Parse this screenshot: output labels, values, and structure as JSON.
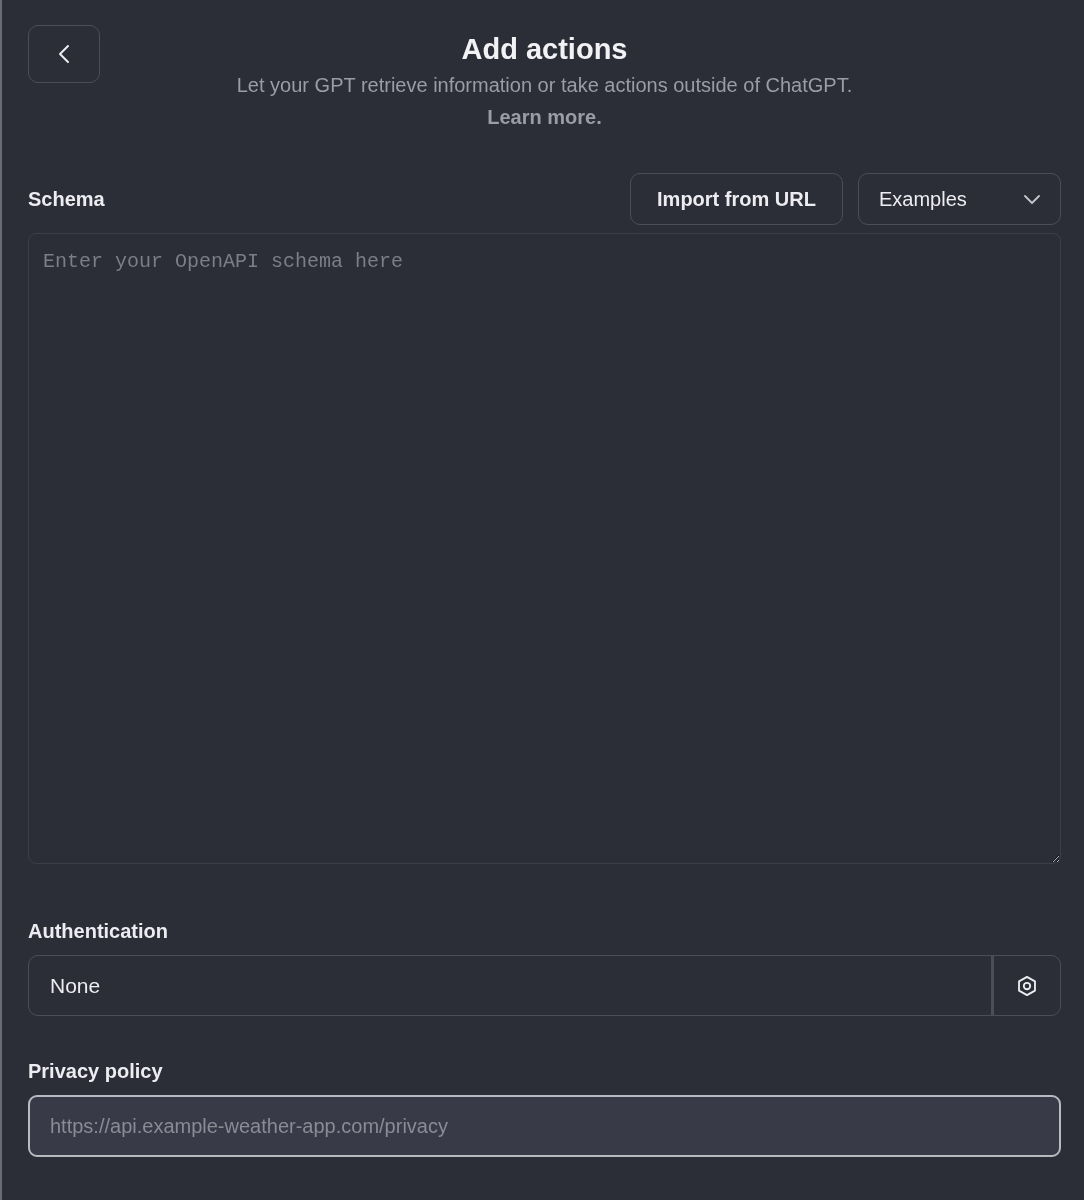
{
  "header": {
    "title": "Add actions",
    "subtitle": "Let your GPT retrieve information or take actions outside of ChatGPT.",
    "link": "Learn more."
  },
  "schema": {
    "label": "Schema",
    "import_button": "Import from URL",
    "examples_dropdown": "Examples",
    "placeholder": "Enter your OpenAPI schema here"
  },
  "authentication": {
    "label": "Authentication",
    "value": "None"
  },
  "privacy_policy": {
    "label": "Privacy policy",
    "placeholder": "https://api.example-weather-app.com/privacy"
  }
}
